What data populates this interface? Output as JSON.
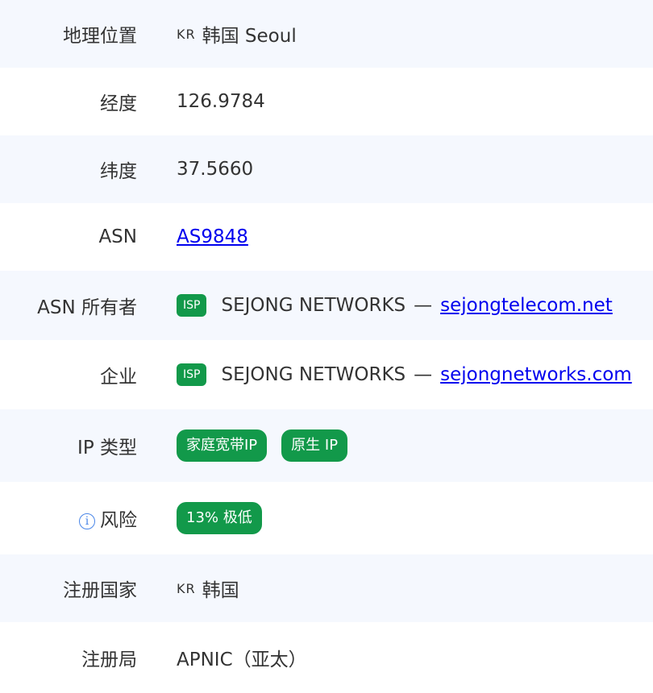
{
  "rows": [
    {
      "label": "地理位置",
      "country_code": "KR",
      "value": "韩国 Seoul"
    },
    {
      "label": "经度",
      "value": "126.9784"
    },
    {
      "label": "纬度",
      "value": "37.5660"
    },
    {
      "label": "ASN",
      "link": "AS9848"
    },
    {
      "label": "ASN 所有者",
      "badge": "ISP",
      "value": "SEJONG NETWORKS",
      "separator": "—",
      "link": "sejongtelecom.net"
    },
    {
      "label": "企业",
      "badge": "ISP",
      "value": "SEJONG NETWORKS",
      "separator": "—",
      "link": "sejongnetworks.com"
    },
    {
      "label": "IP 类型",
      "tags": [
        "家庭宽带IP",
        "原生 IP"
      ]
    },
    {
      "label": "风险",
      "info_icon": "i",
      "tag": "13% 极低"
    },
    {
      "label": "注册国家",
      "country_code": "KR",
      "value": "韩国"
    },
    {
      "label": "注册局",
      "value": "APNIC（亚太）"
    }
  ]
}
